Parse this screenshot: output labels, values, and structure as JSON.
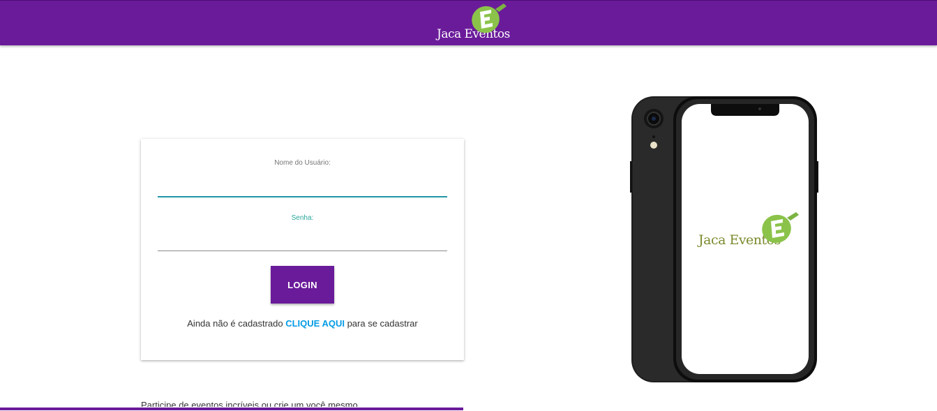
{
  "header": {
    "logo_text": "Jaca Eventos",
    "background_color": "#6a1b9a"
  },
  "login_form": {
    "username_label": "Nome do Usuário:",
    "username_value": "",
    "password_label": "Senha:",
    "password_value": "",
    "login_button": "LOGIN",
    "signup_prefix": "Ainda não é cadastrado ",
    "signup_link": "CLIQUE AQUI",
    "signup_suffix": " para se cadastrar"
  },
  "footer": {
    "tagline": "Participe de eventos incríveis ou crie um você mesmo"
  },
  "phone_mockup": {
    "logo_text": "Jaca Eventos",
    "logo_color": "#7a8b2e"
  },
  "colors": {
    "primary": "#6a1b9a",
    "accent": "#039be5",
    "teal": "#26a69a",
    "leaf_green": "#8bc34a"
  },
  "icons": {
    "logo": "jaca-fruit-e-icon"
  }
}
